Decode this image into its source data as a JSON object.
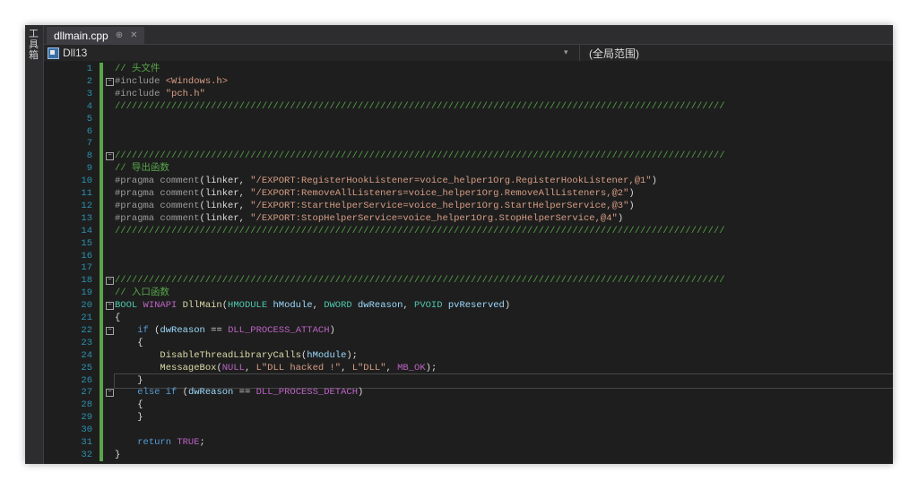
{
  "toolbox_label": "工具箱",
  "tab": {
    "title": "dllmain.cpp",
    "pin": "⊕",
    "close": "✕"
  },
  "nav": {
    "project": "Dll13",
    "scope": "(全局范围)",
    "dropdown": "▾"
  },
  "colors": {
    "background": "#1e1e1e",
    "comment": "#57a64a",
    "string": "#d69d85",
    "keyword": "#569cd6",
    "line_number": "#2b91af",
    "change_bar": "#57a64a"
  },
  "icons": {
    "project": "project-icon",
    "fold": "fold-toggle-icon"
  },
  "lines": [
    {
      "n": "1",
      "tokens": [
        [
          "c-com",
          "// 头文件"
        ]
      ]
    },
    {
      "n": "2",
      "fold": "−",
      "tokens": [
        [
          "c-pre",
          "#include "
        ],
        [
          "c-str",
          "<Windows.h>"
        ]
      ]
    },
    {
      "n": "3",
      "tokens": [
        [
          "c-pre",
          "#include "
        ],
        [
          "c-str",
          "\"pch.h\""
        ]
      ]
    },
    {
      "n": "4",
      "tokens": [
        [
          "c-com",
          "////////////////////////////////////////////////////////////////////////////////////////////////////////////"
        ]
      ]
    },
    {
      "n": "5",
      "tokens": []
    },
    {
      "n": "6",
      "tokens": []
    },
    {
      "n": "7",
      "tokens": []
    },
    {
      "n": "8",
      "fold": "−",
      "tokens": [
        [
          "c-com",
          "////////////////////////////////////////////////////////////////////////////////////////////////////////////"
        ]
      ]
    },
    {
      "n": "9",
      "tokens": [
        [
          "c-com",
          "// 导出函数"
        ]
      ]
    },
    {
      "n": "10",
      "tokens": [
        [
          "c-pre",
          "#pragma comment"
        ],
        [
          "c-ident",
          "(linker, "
        ],
        [
          "c-str",
          "\"/EXPORT:RegisterHookListener=voice_helper1Org.RegisterHookListener,@1\""
        ],
        [
          "c-ident",
          ")"
        ]
      ]
    },
    {
      "n": "11",
      "tokens": [
        [
          "c-pre",
          "#pragma comment"
        ],
        [
          "c-ident",
          "(linker, "
        ],
        [
          "c-str",
          "\"/EXPORT:RemoveAllListeners=voice_helper1Org.RemoveAllListeners,@2\""
        ],
        [
          "c-ident",
          ")"
        ]
      ]
    },
    {
      "n": "12",
      "tokens": [
        [
          "c-pre",
          "#pragma comment"
        ],
        [
          "c-ident",
          "(linker, "
        ],
        [
          "c-str",
          "\"/EXPORT:StartHelperService=voice_helper1Org.StartHelperService,@3\""
        ],
        [
          "c-ident",
          ")"
        ]
      ]
    },
    {
      "n": "13",
      "tokens": [
        [
          "c-pre",
          "#pragma comment"
        ],
        [
          "c-ident",
          "(linker, "
        ],
        [
          "c-str",
          "\"/EXPORT:StopHelperService=voice_helper1Org.StopHelperService,@4\""
        ],
        [
          "c-ident",
          ")"
        ]
      ]
    },
    {
      "n": "14",
      "tokens": [
        [
          "c-com",
          "////////////////////////////////////////////////////////////////////////////////////////////////////////////"
        ]
      ]
    },
    {
      "n": "15",
      "tokens": []
    },
    {
      "n": "16",
      "tokens": []
    },
    {
      "n": "17",
      "tokens": []
    },
    {
      "n": "18",
      "fold": "−",
      "tokens": [
        [
          "c-com",
          "////////////////////////////////////////////////////////////////////////////////////////////////////////////"
        ]
      ]
    },
    {
      "n": "19",
      "tokens": [
        [
          "c-com",
          "// 入口函数"
        ]
      ]
    },
    {
      "n": "20",
      "fold": "−",
      "tokens": [
        [
          "c-type",
          "BOOL "
        ],
        [
          "c-mac",
          "WINAPI "
        ],
        [
          "c-fn",
          "DllMain"
        ],
        [
          "c-ident",
          "("
        ],
        [
          "c-type",
          "HMODULE "
        ],
        [
          "c-param",
          "hModule"
        ],
        [
          "c-ident",
          ", "
        ],
        [
          "c-type",
          "DWORD "
        ],
        [
          "c-param",
          "dwReason"
        ],
        [
          "c-ident",
          ", "
        ],
        [
          "c-type",
          "PVOID "
        ],
        [
          "c-param",
          "pvReserved"
        ],
        [
          "c-ident",
          ")"
        ]
      ]
    },
    {
      "n": "21",
      "tokens": [
        [
          "c-ident",
          "{"
        ]
      ]
    },
    {
      "n": "22",
      "fold": "−",
      "tokens": [
        [
          "c-ident",
          "    "
        ],
        [
          "c-kw",
          "if "
        ],
        [
          "c-ident",
          "("
        ],
        [
          "c-param",
          "dwReason"
        ],
        [
          "c-ident",
          " == "
        ],
        [
          "c-mac",
          "DLL_PROCESS_ATTACH"
        ],
        [
          "c-ident",
          ")"
        ]
      ]
    },
    {
      "n": "23",
      "tokens": [
        [
          "c-ident",
          "    {"
        ]
      ]
    },
    {
      "n": "24",
      "tokens": [
        [
          "c-ident",
          "        "
        ],
        [
          "c-fn",
          "DisableThreadLibraryCalls"
        ],
        [
          "c-ident",
          "("
        ],
        [
          "c-param",
          "hModule"
        ],
        [
          "c-ident",
          ");"
        ]
      ]
    },
    {
      "n": "25",
      "tokens": [
        [
          "c-ident",
          "        "
        ],
        [
          "c-fn",
          "MessageBox"
        ],
        [
          "c-ident",
          "("
        ],
        [
          "c-mac",
          "NULL"
        ],
        [
          "c-ident",
          ", "
        ],
        [
          "c-str",
          "L\"DLL hacked !\""
        ],
        [
          "c-ident",
          ", "
        ],
        [
          "c-str",
          "L\"DLL\""
        ],
        [
          "c-ident",
          ", "
        ],
        [
          "c-mac",
          "MB_OK"
        ],
        [
          "c-ident",
          ");"
        ]
      ]
    },
    {
      "n": "26",
      "current": true,
      "tokens": [
        [
          "c-ident",
          "    }"
        ]
      ]
    },
    {
      "n": "27",
      "fold": "−",
      "tokens": [
        [
          "c-ident",
          "    "
        ],
        [
          "c-kw",
          "else if "
        ],
        [
          "c-ident",
          "("
        ],
        [
          "c-param",
          "dwReason"
        ],
        [
          "c-ident",
          " == "
        ],
        [
          "c-mac",
          "DLL_PROCESS_DETACH"
        ],
        [
          "c-ident",
          ")"
        ]
      ]
    },
    {
      "n": "28",
      "tokens": [
        [
          "c-ident",
          "    {"
        ]
      ]
    },
    {
      "n": "29",
      "tokens": [
        [
          "c-ident",
          "    }"
        ]
      ]
    },
    {
      "n": "30",
      "tokens": []
    },
    {
      "n": "31",
      "tokens": [
        [
          "c-ident",
          "    "
        ],
        [
          "c-kw",
          "return "
        ],
        [
          "c-mac",
          "TRUE"
        ],
        [
          "c-ident",
          ";"
        ]
      ]
    },
    {
      "n": "32",
      "tokens": [
        [
          "c-ident",
          "}"
        ]
      ]
    }
  ]
}
